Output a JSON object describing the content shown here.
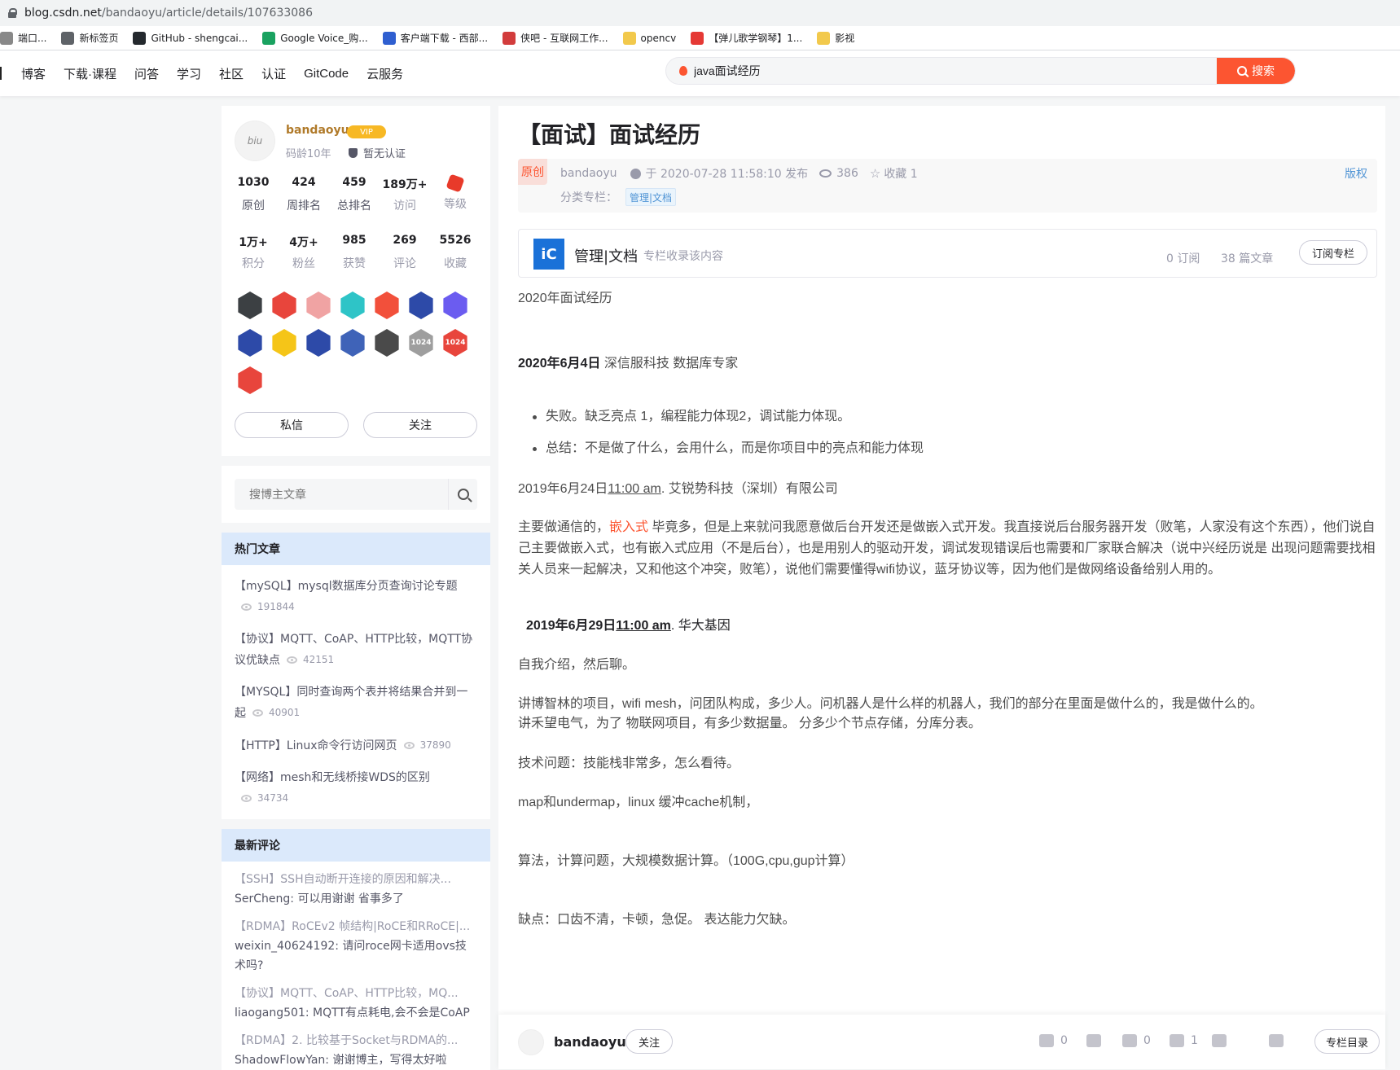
{
  "browser": {
    "url_host": "blog.csdn.net",
    "url_path": "/bandaoyu/article/details/107633086",
    "bookmarks": [
      {
        "label": "端口...",
        "icon": "tab-icon",
        "color": "#888888"
      },
      {
        "label": "新标签页",
        "icon": "globe-icon",
        "color": "#5f6368"
      },
      {
        "label": "GitHub - shengcai...",
        "icon": "github-icon",
        "color": "#24292e"
      },
      {
        "label": "Google Voice_购...",
        "icon": "voice-icon",
        "color": "#1aa260"
      },
      {
        "label": "客户端下载 - 西部...",
        "icon": "w-icon",
        "color": "#2f5fd0"
      },
      {
        "label": "侠吧 - 互联网工作...",
        "icon": "xiaba-icon",
        "color": "#d23c3c"
      },
      {
        "label": "opencv",
        "icon": "folder-icon",
        "color": "#f2c94c"
      },
      {
        "label": "【弹儿歌学钢琴】1...",
        "icon": "ting-icon",
        "color": "#e53935"
      },
      {
        "label": "影视",
        "icon": "folder-icon",
        "color": "#f2c94c"
      }
    ]
  },
  "nav": {
    "items": [
      "博客",
      "下载·课程",
      "问答",
      "学习",
      "社区",
      "认证",
      "GitCode",
      "云服务"
    ],
    "search_value": "java面试经历",
    "search_button": "搜索"
  },
  "profile": {
    "username": "bandaoyu",
    "vip": "VIP",
    "age": "码龄10年",
    "cert": "暂无认证",
    "stats_row1": [
      {
        "num": "1030",
        "label": "原创"
      },
      {
        "num": "424",
        "label": "周排名"
      },
      {
        "num": "459",
        "label": "总排名"
      },
      {
        "num": "189万+",
        "label": "访问"
      },
      {
        "num": "",
        "label": "等级"
      }
    ],
    "stats_row2": [
      {
        "num": "1万+",
        "label": "积分"
      },
      {
        "num": "4万+",
        "label": "粉丝"
      },
      {
        "num": "985",
        "label": "获赞"
      },
      {
        "num": "269",
        "label": "评论"
      },
      {
        "num": "5526",
        "label": "收藏"
      }
    ],
    "badges": [
      {
        "color": "#3c4043",
        "text": ""
      },
      {
        "color": "#e8453c",
        "text": ""
      },
      {
        "color": "#f0a3a3",
        "text": ""
      },
      {
        "color": "#2ec4c7",
        "text": ""
      },
      {
        "color": "#f2503b",
        "text": ""
      },
      {
        "color": "#2d4aa8",
        "text": ""
      },
      {
        "color": "#6b5cf0",
        "text": ""
      },
      {
        "color": "#2d4aa8",
        "text": ""
      },
      {
        "color": "#f5c518",
        "text": ""
      },
      {
        "color": "#2d4aa8",
        "text": ""
      },
      {
        "color": "#3f63b8",
        "text": ""
      },
      {
        "color": "#4a4a4a",
        "text": ""
      },
      {
        "color": "#9e9e9e",
        "text": "1024"
      },
      {
        "color": "#e8453c",
        "text": "1024"
      },
      {
        "color": "#e8453c",
        "text": ""
      }
    ],
    "message_button": "私信",
    "follow_button": "关注"
  },
  "blog_search": {
    "placeholder": "搜博主文章"
  },
  "hot": {
    "title": "热门文章",
    "items": [
      {
        "title": "【mySQL】mysql数据库分页查询讨论专题",
        "views": "191844"
      },
      {
        "title": "【协议】MQTT、CoAP、HTTP比较，MQTT协议优缺点",
        "views": "42151"
      },
      {
        "title": "【MYSQL】同时查询两个表并将结果合并到一起",
        "views": "40901"
      },
      {
        "title": "【HTTP】Linux命令行访问网页",
        "views": "37890"
      },
      {
        "title": "【网络】mesh和无线桥接WDS的区别",
        "views": "34734"
      }
    ]
  },
  "comments": {
    "title": "最新评论",
    "items": [
      {
        "article": "【SSH】SSH自动断开连接的原因和解决...",
        "text": "SerCheng: 可以用谢谢 省事多了"
      },
      {
        "article": "【RDMA】RoCEv2 帧结构|RoCE和RRoCE|...",
        "text": "weixin_40624192: 请问roce网卡适用ovs技术吗?"
      },
      {
        "article": "【协议】MQTT、CoAP、HTTP比较，MQ...",
        "text": "liaogang501: MQTT有点耗电,会不会是CoAP"
      },
      {
        "article": "【RDMA】2. 比较基于Socket与RDMA的...",
        "text": "ShadowFlowYan: 谢谢博主，写得太好啦"
      }
    ]
  },
  "article": {
    "title": "【面试】面试经历",
    "original": "原创",
    "author": "bandaoyu",
    "date": "于 2020-07-28 11:58:10 发布",
    "views": "386",
    "favorites": "收藏 1",
    "column_label": "分类专栏：",
    "column_tag": "管理|文档",
    "copyright": "版权",
    "column": {
      "icon_text": "iC",
      "name": "管理|文档",
      "desc": "专栏收录该内容",
      "subs": "0 订阅",
      "count": "38 篇文章",
      "button": "订阅专栏"
    },
    "p1": "2020年面试经历",
    "p2_bold": "2020年6月4日",
    "p2_rest": " 深信服科技 数据库专家",
    "li1": "失败。缺乏亮点 1，编程能力体现2，调试能力体现。",
    "li2": "总结：不是做了什么，会用什么，而是你项目中的亮点和能力体现",
    "p3_a": "2019年6月24日",
    "p3_u": "11:00 am",
    "p3_b": ". 艾锐势科技（深圳）有限公司",
    "p4_a": "主要做通信的，",
    "p4_kw": "嵌入式",
    "p4_b": " 毕竟多，但是上来就问我愿意做后台开发还是做嵌入式开发。我直接说后台服务器开发（败笔，人家没有这个东西），他们说自己主要做嵌入式，也有嵌入式应用（不是后台），也是用别人的驱动开发，调试发现错误后也需要和厂家联合解决（说中兴经历说是 出现问题需要找相关人员来一起解决，又和他这个冲突，败笔），说他们需要懂得wifi协议，蓝牙协议等，因为他们是做网络设备给别人用的。",
    "p5_a": "2019年6月29日",
    "p5_u": "11:00 am",
    "p5_b": ". 华大基因",
    "p6": "自我介绍，然后聊。",
    "p7": "讲博智林的项目，wifi mesh，问团队构成，多少人。问机器人是什么样的机器人，我们的部分在里面是做什么的，我是做什么的。",
    "p8": "讲禾望电气，为了 物联网项目，有多少数据量。 分多少个节点存储，分库分表。",
    "p9": "技术问题：技能栈非常多，怎么看待。",
    "p10": "map和undermap，linux 缓冲cache机制，",
    "p11": "算法，计算问题，大规模数据计算。（100G,cpu,gup计算）",
    "p12": "缺点：口齿不清，卡顿，急促。 表达能力欠缺。"
  },
  "toolbar": {
    "author": "bandaoyu",
    "follow": "关注",
    "like": "0",
    "dislike": "",
    "comment": "0",
    "favorite": "1",
    "directory": "专栏目录"
  }
}
